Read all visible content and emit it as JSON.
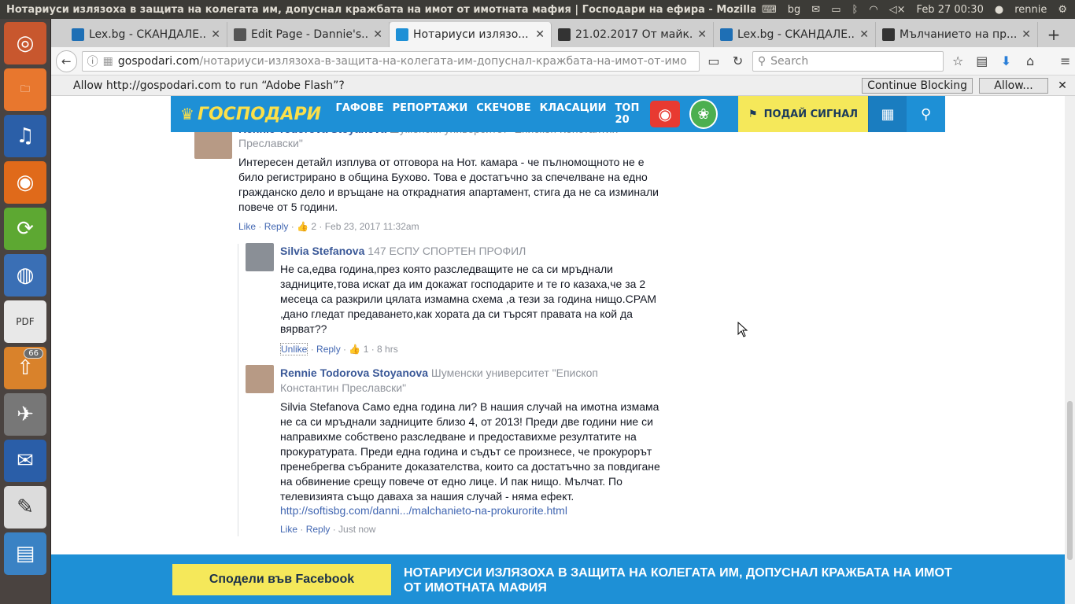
{
  "system": {
    "window_title": "Нотариуси излязоха в защита на колегата им, допуснал кражбата на имот от имотната мафия | Господари на ефира - Mozilla Firef",
    "keyboard": "bg",
    "datetime": "Feb 27 00:30",
    "user": "rennie"
  },
  "launcher": {
    "items": [
      {
        "name": "ubuntu-dash-icon",
        "glyph": "◎",
        "color": "#c8572e"
      },
      {
        "name": "files-icon",
        "glyph": "🗀",
        "color": "#e8772e"
      },
      {
        "name": "audacity-icon",
        "glyph": "♫",
        "color": "#2b5fa8"
      },
      {
        "name": "firefox-icon",
        "glyph": "◉",
        "color": "#e06a1a"
      },
      {
        "name": "backup-icon",
        "glyph": "⟳",
        "color": "#5da832"
      },
      {
        "name": "chromium-icon",
        "glyph": "◍",
        "color": "#3a6fb5"
      },
      {
        "name": "pdf-icon",
        "glyph": "PDF",
        "color": "#e8e8e8"
      },
      {
        "name": "updates-icon",
        "glyph": "⇧",
        "color": "#d9822b"
      },
      {
        "name": "jet-icon",
        "glyph": "✈",
        "color": "#777777"
      },
      {
        "name": "thunderbird-icon",
        "glyph": "✉",
        "color": "#2a5ea8"
      },
      {
        "name": "text-editor-icon",
        "glyph": "✎",
        "color": "#dcdcdc"
      },
      {
        "name": "document-viewer-icon",
        "glyph": "▤",
        "color": "#3a82c4"
      }
    ],
    "badge": "66"
  },
  "tabs": [
    {
      "label": "Lex.bg - СКАНДАЛЕ...",
      "fav": "#1e6fb5",
      "active": false
    },
    {
      "label": "Edit Page - Dannie's...",
      "fav": "#555555",
      "active": false
    },
    {
      "label": "Нотариуси излязо...",
      "fav": "#1e90d6",
      "active": true
    },
    {
      "label": "21.02.2017 От майк...",
      "fav": "#333333",
      "active": false
    },
    {
      "label": "Lex.bg - СКАНДАЛЕ...",
      "fav": "#1e6fb5",
      "active": false
    },
    {
      "label": "Мълчанието на пр...",
      "fav": "#333333",
      "active": false
    }
  ],
  "navbar": {
    "url_domain": "gospodari.com",
    "url_path": "/нотариуси-излязоха-в-защита-на-колегата-им-допуснал-кражбата-на-имот-от-имо",
    "search_placeholder": "Search"
  },
  "flash": {
    "message": "Allow http://gospodari.com to run “Adobe Flash”?",
    "continue_label": "Continue Blocking",
    "allow_label": "Allow..."
  },
  "site": {
    "logo_text": "ГОСПОДАРИ",
    "nav": [
      "ГАФОВЕ",
      "РЕПОРТАЖИ",
      "СКЕЧОВЕ",
      "КЛАСАЦИИ",
      "ТОП 20"
    ],
    "report_label": "ПОДАЙ СИГНАЛ"
  },
  "comments": {
    "top": {
      "author_partial": "Rennie Todorova Stoyanova",
      "sub_partial": "Шуменски университет \"Епископ Константин",
      "sub_line2": "Преславски\"",
      "text": "Интересен детайл изплува от отговора на Нот. камара - че пълномощното не е било регистрирано в община Бухово. Това е достатъчно за спечелване на едно гражданско дело и връщане на откраднатия апартамент, стига да не са изминали повече от 5 години.",
      "like": "Like",
      "reply": "Reply",
      "likes": "2",
      "time": "Feb 23, 2017 11:32am"
    },
    "reply1": {
      "author": "Silvia Stefanova",
      "sub": "147 ЕСПУ СПОРТЕН ПРОФИЛ",
      "text": "Не са,едва година,през която разследващите не са си мръднали задниците,това искат да им докажат господарите и те го казаха,че за 2 месеца са разкрили цялата измамна схема ,а тези за година нищо.СРАМ ,дано гледат предаването,как хората да си търсят правата на кой да вярват??",
      "like": "Unlike",
      "reply": "Reply",
      "likes": "1",
      "time": "8 hrs"
    },
    "reply2": {
      "author": "Rennie Todorova Stoyanova",
      "sub": "Шуменски университет \"Епископ",
      "sub_line2": "Константин Преславски\"",
      "text": "Silvia Stefanova Само една година ли? В нашия случай на имотна измама не са си мръднали задниците близо 4, от 2013! Преди две години ние си направихме собствено разследване и предоставихме резултатите на прокуратурата. Преди една година и съдът се произнесе, че прокурорът пренебрегва събраните доказателства, които са достатъчно за повдигане на обвинение срещу повече от едно лице. И пак нищо. Мълчат. По телевизията също даваха за нашия случай - няма ефект.",
      "link": "http://softisbg.com/danni.../malchanieto-na-prokurorite.html",
      "like": "Like",
      "reply": "Reply",
      "time": "Just now"
    }
  },
  "share": {
    "button": "Сподели във Facebook",
    "title": "НОТАРИУСИ ИЗЛЯЗОХА В ЗАЩИТА НА КОЛЕГАТА ИМ, ДОПУСНАЛ КРАЖБАТА НА ИМОТ ОТ ИМОТНАТА МАФИЯ"
  }
}
